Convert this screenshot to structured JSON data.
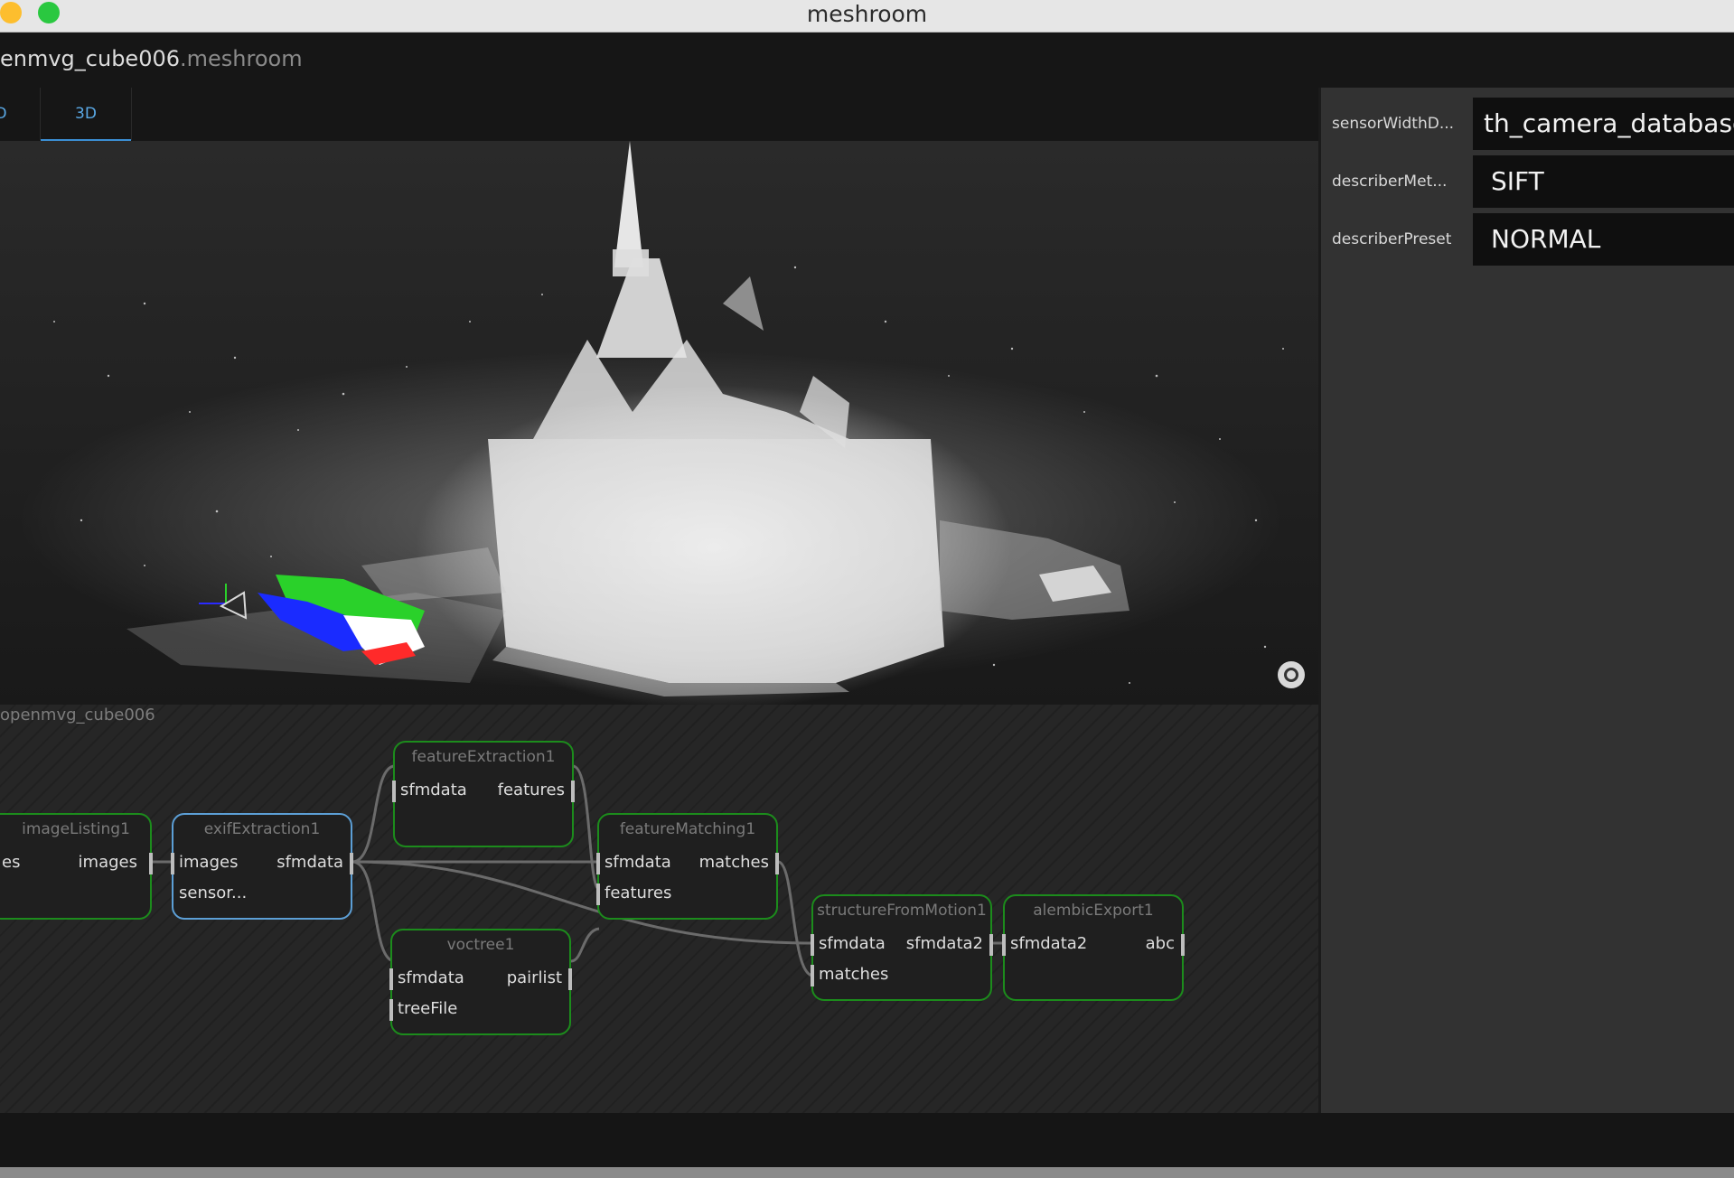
{
  "window": {
    "title": "meshroom",
    "colors": {
      "close": "#fdbe2e",
      "zoom": "#2ac840"
    }
  },
  "project": {
    "name": "enmvg_cube006",
    "extension": ".meshroom"
  },
  "tabs": [
    {
      "label": "D",
      "active": false
    },
    {
      "label": "3D",
      "active": true
    }
  ],
  "viewport": {
    "recenter_icon": "target-icon"
  },
  "graph": {
    "label": "openmvg_cube006",
    "nodes": {
      "imageListing": {
        "title": "imageListing1",
        "in": "es",
        "out": "images"
      },
      "exifExtraction": {
        "title": "exifExtraction1",
        "in1": "images",
        "in2": "sensor...",
        "out": "sfmdata"
      },
      "featureExtraction": {
        "title": "featureExtraction1",
        "in": "sfmdata",
        "out": "features"
      },
      "featureMatching": {
        "title": "featureMatching1",
        "in1": "sfmdata",
        "in2": "features",
        "out": "matches"
      },
      "voctree": {
        "title": "voctree1",
        "in1": "sfmdata",
        "in2": "treeFile",
        "out": "pairlist"
      },
      "structureFromMotion": {
        "title": "structureFromMotion1",
        "in1": "sfmdata",
        "in2": "matches",
        "out": "sfmdata2"
      },
      "alembicExport": {
        "title": "alembicExport1",
        "in": "sfmdata2",
        "out": "abc"
      }
    },
    "colors": {
      "node_border": "#1c8c1c",
      "selected_border": "#5c9fd6"
    }
  },
  "params": [
    {
      "label": "sensorWidthD...",
      "value": "th_camera_database.t"
    },
    {
      "label": "describerMet...",
      "value": "SIFT"
    },
    {
      "label": "describerPreset",
      "value": "NORMAL"
    }
  ]
}
